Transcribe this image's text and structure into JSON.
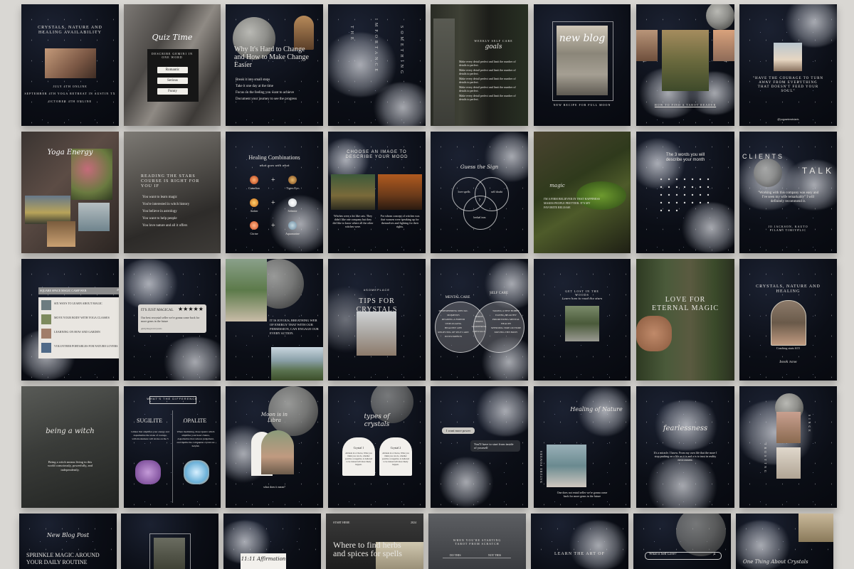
{
  "colors": {
    "page_bg": "#d9d7d3",
    "tile_dark": "#0c0f17",
    "text_light": "#e8e6e2"
  },
  "row1": {
    "t1": {
      "title": "CRYSTALS, NATURE AND HEALING AVAILABILITY",
      "dates": [
        "JULY 4th ONLINE",
        "SEPTEMBER 4th YOGA RETREAT IN AUSTIN TX",
        "OCTOBER 4th ONLINE"
      ]
    },
    "t2": {
      "title": "Quiz Time",
      "subtitle": "DESCRIBE GEMINI IN ONE WORD",
      "options": [
        "Romantic",
        "Serious",
        "Funny"
      ]
    },
    "t3": {
      "title": "Why It's Hard to Change and How to Make Change Easier",
      "lines": [
        "Break it into small steps",
        "Take it one day at the time",
        "Focus on the feeling you want to achieve",
        "Document your journey to see the progress"
      ]
    },
    "t4": {
      "words": [
        "THE",
        "IMPORTANCE",
        "SOMETHING"
      ]
    },
    "t5": {
      "title": "goals",
      "tagline": "WEEKLY SELF CARE",
      "lines": [
        "Make every detail perfect and limit the number of details to perfect.",
        "Make every detail perfect and limit the number of details to perfect.",
        "Make every detail perfect and limit the number of details to perfect.",
        "Make every detail perfect and limit the number of details to perfect.",
        "Make every detail perfect and limit the number of details to perfect."
      ]
    },
    "t6": {
      "title": "new blog",
      "caption": "NEW RECIPE FOR FULL MOON"
    },
    "t7": {
      "caption": "HOW TO FIND A TAROT READER"
    },
    "t8": {
      "quote": "\"HAVE THE COURAGE TO TURN AWAY FROM EVERYTHING THAT DOESN'T FEED YOUR SOUL\"",
      "handle": "@yogaretreatstarts"
    }
  },
  "row2": {
    "t1": {
      "title": "Yoga Energy"
    },
    "t2": {
      "title": "READING THE STARS COURSE IS RIGHT FOR YOU IF",
      "lines": [
        "You want to learn magic",
        "You're interested in witch history",
        "You believe in astrology",
        "You want to help people",
        "You love nature and all it offers"
      ]
    },
    "t3": {
      "title": "Healing Combinations",
      "subtitle": "what goes with what",
      "left": [
        "Carnelian",
        "Amber",
        "Citrine"
      ],
      "right": [
        "Tigers Eye",
        "Selenite",
        "Aquamarine"
      ]
    },
    "t4": {
      "title": "CHOOSE AN IMAGE TO DESCRIBE YOUR MOOD",
      "left_text": "Witches were a lot like cats. They didn't like one company but they did like to know where all the other witches were.",
      "right_text": "For whom concept of witches was that women were speaking up for themselves and fighting for their rights."
    },
    "t5": {
      "title": "Guess the Sign",
      "labels": [
        "love spells",
        "self doubt",
        "herbal teas",
        "?"
      ]
    },
    "t6": {
      "title": "magic",
      "body": "I'M A FIRM BELIEVER IN THAT HAPPINESS MAKES PEOPLE PRETTIER. IT'S MY FAVORITE RELEASE"
    },
    "t7": {
      "title": "The 3 words you will describe your month"
    },
    "t8": {
      "title_left": "CLIENTS",
      "title_right": "TALK",
      "quote": "\"Working with this company was easy and I've seen my wife remarkably\" I will definitely recommend it.",
      "author": "JO JACKSON, KAUTO PILAMI TIMIYELIC"
    }
  },
  "row3": {
    "t1": {
      "header": "SQUARE SPACE MAGIC CAMP WEB",
      "items": [
        "SIX WAYS TO LEARN ABOUT MAGIC",
        "MOVE YOUR BODY WITH YOGA CLASSES",
        "LEARNING ON HOW AND GARDEN",
        "VOLUNTEER PORTABLES FOR NATURE LOVERS"
      ]
    },
    "t2": {
      "title": "IT'S JUST MAGICAL",
      "stars": "★★★★★",
      "body": "Our best recrystal seller we're gonna come back for more gems in the future",
      "handle": "@mymagicalcrystals"
    },
    "t3": {
      "body": "IT IS JOYOUS, BREATHING WEB OF ENERGY THAT WITH OUR PERMISSION, CAN ENGAGE OUR EVERY ACTION."
    },
    "t4": {
      "tag": "#SOMEPLACE",
      "title": "TIPS FOR CRYSTALS"
    },
    "t5": {
      "left_title": "MENTAL CARE",
      "right_title": "SELF CARE",
      "left": [
        "REMEMBERING SPECIAL MOMENTS",
        "READING A FRIEND",
        "UNPLUGGING",
        "HEALTHY LIFE",
        "RELIEVING OF SELF CARE",
        "INVESTMENTS"
      ],
      "middle": [
        "TAROT",
        "HERBS",
        "GARDENING",
        "CRYSTALS"
      ],
      "right": [
        "TAKING A NEW HOBBY",
        "EATING HEALTHY",
        "PRIORITIZING MENTAL HEALTH",
        "SPENDING TIME OUTSIDE",
        "MOVING THE BODY"
      ]
    },
    "t6": {
      "title": "GET LOST IN THE WOODS",
      "subtitle": "Learn how to read the stars"
    },
    "t7": {
      "title": "LOVE FOR ETERNAL MAGIC"
    },
    "t8": {
      "title": "CRYSTALS, NATURE AND HEALING",
      "caption": "Coaching starts 6/15",
      "sign": "book now"
    }
  },
  "row4": {
    "t1": {
      "title": "being a witch",
      "body": "Being a witch means living in this world consciously, powerfully, and independently."
    },
    "t2": {
      "tag": "WHAT'S THE DIFFERENCE",
      "left_title": "SUGILITE",
      "right_title": "OPALITE",
      "left_text": "Glinter that amplifies your energy and Aquamarine the stone of courage, with modestness will stroke on the 3",
      "right_text": "When meditating, Rose Quartz which amplifies your heart chakra, Aquamarine that reduces judgement, and Opalite the companion crystal are helpful."
    },
    "t3": {
      "title": "Moon is in Libra",
      "caption": "what does it mean?"
    },
    "t4": {
      "title": "types of crystals",
      "left_label": "Crystal 1",
      "right_label": "Crystal 2",
      "left_text": "Altitude in a Choice, What you think you can do, whether positive or negative, is believed to be trained will more likely happen.",
      "right_text": "Altitude in a Choice, What you think you can do, whether positive or negative, is believed to be trained will more likely happen."
    },
    "t5": {
      "bubble1": "I want more power",
      "bubble2": "You'll have to start from inside of yourself"
    },
    "t6": {
      "title": "Healing of Nature",
      "side": "NATURE POWERS",
      "caption": "One does not entail seller we're gonna come back for more gems in the future"
    },
    "t7": {
      "title": "fearlessness",
      "body": "It's a miracle. I know. From my own life that the more I stop pushing on a life as it is and a is to trust in reality environment."
    },
    "t8": {
      "side": "TRUSTING",
      "side2": "SINCE"
    }
  },
  "row5": {
    "t1": {
      "title": "New Blog Post",
      "body": "SPRINKLE MAGIC AROUND YOUR DAILY ROUTINE"
    },
    "t2": {},
    "t3": {
      "title": "11:11 Affirmation"
    },
    "t4": {
      "tag_left": "START HERE",
      "tag_right": "2024",
      "title": "Where to find herbs and spices for spells"
    },
    "t5": {
      "title": "WHEN YOU'RE STARTING TAROT FROM SCRATCH",
      "left": "DO THIS",
      "right": "NOT THIS"
    },
    "t6": {
      "title": "LEARN THE ART OF"
    },
    "t7": {
      "search": "What is Self Love?"
    },
    "t8": {
      "title": "One Thing About Crystals"
    }
  }
}
